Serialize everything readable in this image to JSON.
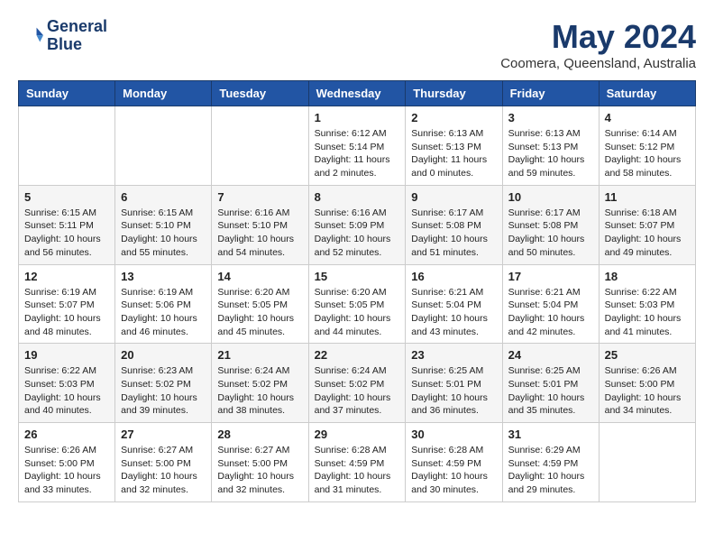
{
  "header": {
    "logo_line1": "General",
    "logo_line2": "Blue",
    "month_title": "May 2024",
    "subtitle": "Coomera, Queensland, Australia"
  },
  "weekdays": [
    "Sunday",
    "Monday",
    "Tuesday",
    "Wednesday",
    "Thursday",
    "Friday",
    "Saturday"
  ],
  "weeks": [
    [
      {
        "day": "",
        "info": ""
      },
      {
        "day": "",
        "info": ""
      },
      {
        "day": "",
        "info": ""
      },
      {
        "day": "1",
        "info": "Sunrise: 6:12 AM\nSunset: 5:14 PM\nDaylight: 11 hours\nand 2 minutes."
      },
      {
        "day": "2",
        "info": "Sunrise: 6:13 AM\nSunset: 5:13 PM\nDaylight: 11 hours\nand 0 minutes."
      },
      {
        "day": "3",
        "info": "Sunrise: 6:13 AM\nSunset: 5:13 PM\nDaylight: 10 hours\nand 59 minutes."
      },
      {
        "day": "4",
        "info": "Sunrise: 6:14 AM\nSunset: 5:12 PM\nDaylight: 10 hours\nand 58 minutes."
      }
    ],
    [
      {
        "day": "5",
        "info": "Sunrise: 6:15 AM\nSunset: 5:11 PM\nDaylight: 10 hours\nand 56 minutes."
      },
      {
        "day": "6",
        "info": "Sunrise: 6:15 AM\nSunset: 5:10 PM\nDaylight: 10 hours\nand 55 minutes."
      },
      {
        "day": "7",
        "info": "Sunrise: 6:16 AM\nSunset: 5:10 PM\nDaylight: 10 hours\nand 54 minutes."
      },
      {
        "day": "8",
        "info": "Sunrise: 6:16 AM\nSunset: 5:09 PM\nDaylight: 10 hours\nand 52 minutes."
      },
      {
        "day": "9",
        "info": "Sunrise: 6:17 AM\nSunset: 5:08 PM\nDaylight: 10 hours\nand 51 minutes."
      },
      {
        "day": "10",
        "info": "Sunrise: 6:17 AM\nSunset: 5:08 PM\nDaylight: 10 hours\nand 50 minutes."
      },
      {
        "day": "11",
        "info": "Sunrise: 6:18 AM\nSunset: 5:07 PM\nDaylight: 10 hours\nand 49 minutes."
      }
    ],
    [
      {
        "day": "12",
        "info": "Sunrise: 6:19 AM\nSunset: 5:07 PM\nDaylight: 10 hours\nand 48 minutes."
      },
      {
        "day": "13",
        "info": "Sunrise: 6:19 AM\nSunset: 5:06 PM\nDaylight: 10 hours\nand 46 minutes."
      },
      {
        "day": "14",
        "info": "Sunrise: 6:20 AM\nSunset: 5:05 PM\nDaylight: 10 hours\nand 45 minutes."
      },
      {
        "day": "15",
        "info": "Sunrise: 6:20 AM\nSunset: 5:05 PM\nDaylight: 10 hours\nand 44 minutes."
      },
      {
        "day": "16",
        "info": "Sunrise: 6:21 AM\nSunset: 5:04 PM\nDaylight: 10 hours\nand 43 minutes."
      },
      {
        "day": "17",
        "info": "Sunrise: 6:21 AM\nSunset: 5:04 PM\nDaylight: 10 hours\nand 42 minutes."
      },
      {
        "day": "18",
        "info": "Sunrise: 6:22 AM\nSunset: 5:03 PM\nDaylight: 10 hours\nand 41 minutes."
      }
    ],
    [
      {
        "day": "19",
        "info": "Sunrise: 6:22 AM\nSunset: 5:03 PM\nDaylight: 10 hours\nand 40 minutes."
      },
      {
        "day": "20",
        "info": "Sunrise: 6:23 AM\nSunset: 5:02 PM\nDaylight: 10 hours\nand 39 minutes."
      },
      {
        "day": "21",
        "info": "Sunrise: 6:24 AM\nSunset: 5:02 PM\nDaylight: 10 hours\nand 38 minutes."
      },
      {
        "day": "22",
        "info": "Sunrise: 6:24 AM\nSunset: 5:02 PM\nDaylight: 10 hours\nand 37 minutes."
      },
      {
        "day": "23",
        "info": "Sunrise: 6:25 AM\nSunset: 5:01 PM\nDaylight: 10 hours\nand 36 minutes."
      },
      {
        "day": "24",
        "info": "Sunrise: 6:25 AM\nSunset: 5:01 PM\nDaylight: 10 hours\nand 35 minutes."
      },
      {
        "day": "25",
        "info": "Sunrise: 6:26 AM\nSunset: 5:00 PM\nDaylight: 10 hours\nand 34 minutes."
      }
    ],
    [
      {
        "day": "26",
        "info": "Sunrise: 6:26 AM\nSunset: 5:00 PM\nDaylight: 10 hours\nand 33 minutes."
      },
      {
        "day": "27",
        "info": "Sunrise: 6:27 AM\nSunset: 5:00 PM\nDaylight: 10 hours\nand 32 minutes."
      },
      {
        "day": "28",
        "info": "Sunrise: 6:27 AM\nSunset: 5:00 PM\nDaylight: 10 hours\nand 32 minutes."
      },
      {
        "day": "29",
        "info": "Sunrise: 6:28 AM\nSunset: 4:59 PM\nDaylight: 10 hours\nand 31 minutes."
      },
      {
        "day": "30",
        "info": "Sunrise: 6:28 AM\nSunset: 4:59 PM\nDaylight: 10 hours\nand 30 minutes."
      },
      {
        "day": "31",
        "info": "Sunrise: 6:29 AM\nSunset: 4:59 PM\nDaylight: 10 hours\nand 29 minutes."
      },
      {
        "day": "",
        "info": ""
      }
    ]
  ]
}
